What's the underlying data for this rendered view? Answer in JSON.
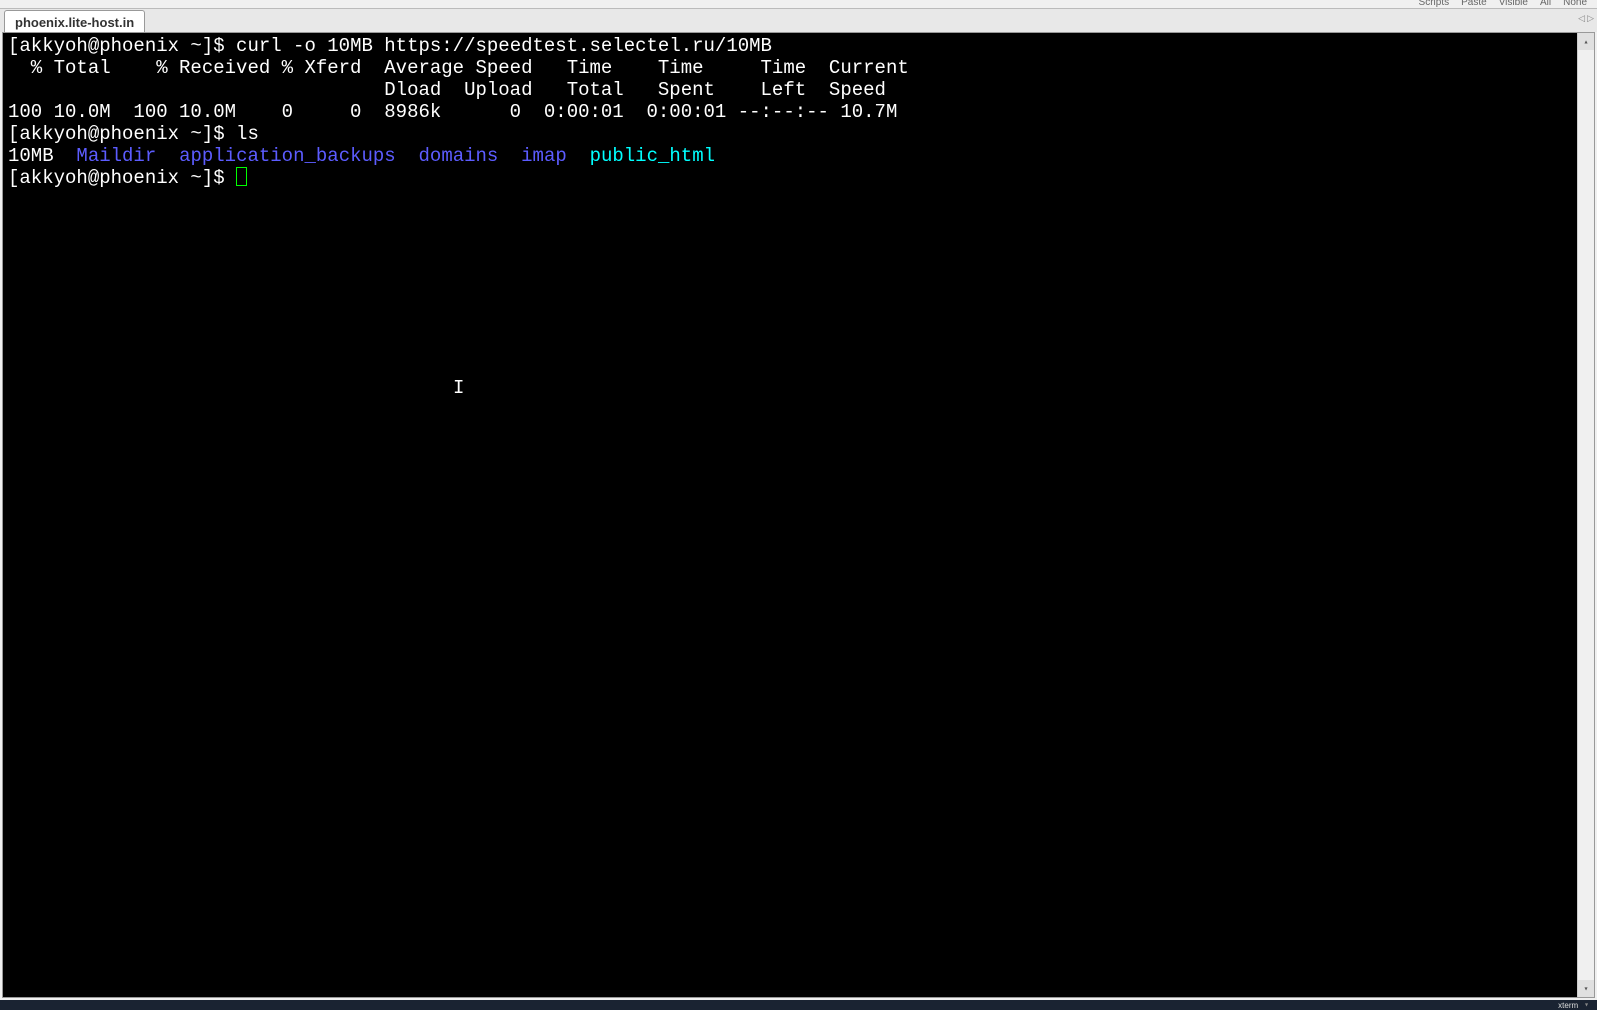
{
  "toolbar": {
    "scripts": "Scripts",
    "paste": "Paste",
    "visible": "Visible",
    "all": "All",
    "none": "None"
  },
  "tabs": {
    "active": "phoenix.lite-host.in"
  },
  "terminal": {
    "prompt": "[akkyoh@phoenix ~]$ ",
    "cmd1": "curl -o 10MB https://speedtest.selectel.ru/10MB",
    "stats_header1": "  % Total    % Received % Xferd  Average Speed   Time    Time     Time  Current",
    "stats_header2": "                                 Dload  Upload   Total   Spent    Left  Speed",
    "stats_row": "100 10.0M  100 10.0M    0     0  8986k      0  0:00:01  0:00:01 --:--:-- 10.7M",
    "cmd2": "ls",
    "ls": {
      "file1": "10MB",
      "dir1": "Maildir",
      "dir2": "application_backups",
      "dir3": "domains",
      "dir4": "imap",
      "link1": "public_html"
    }
  },
  "statusbar": {
    "encoding": "xterm"
  }
}
